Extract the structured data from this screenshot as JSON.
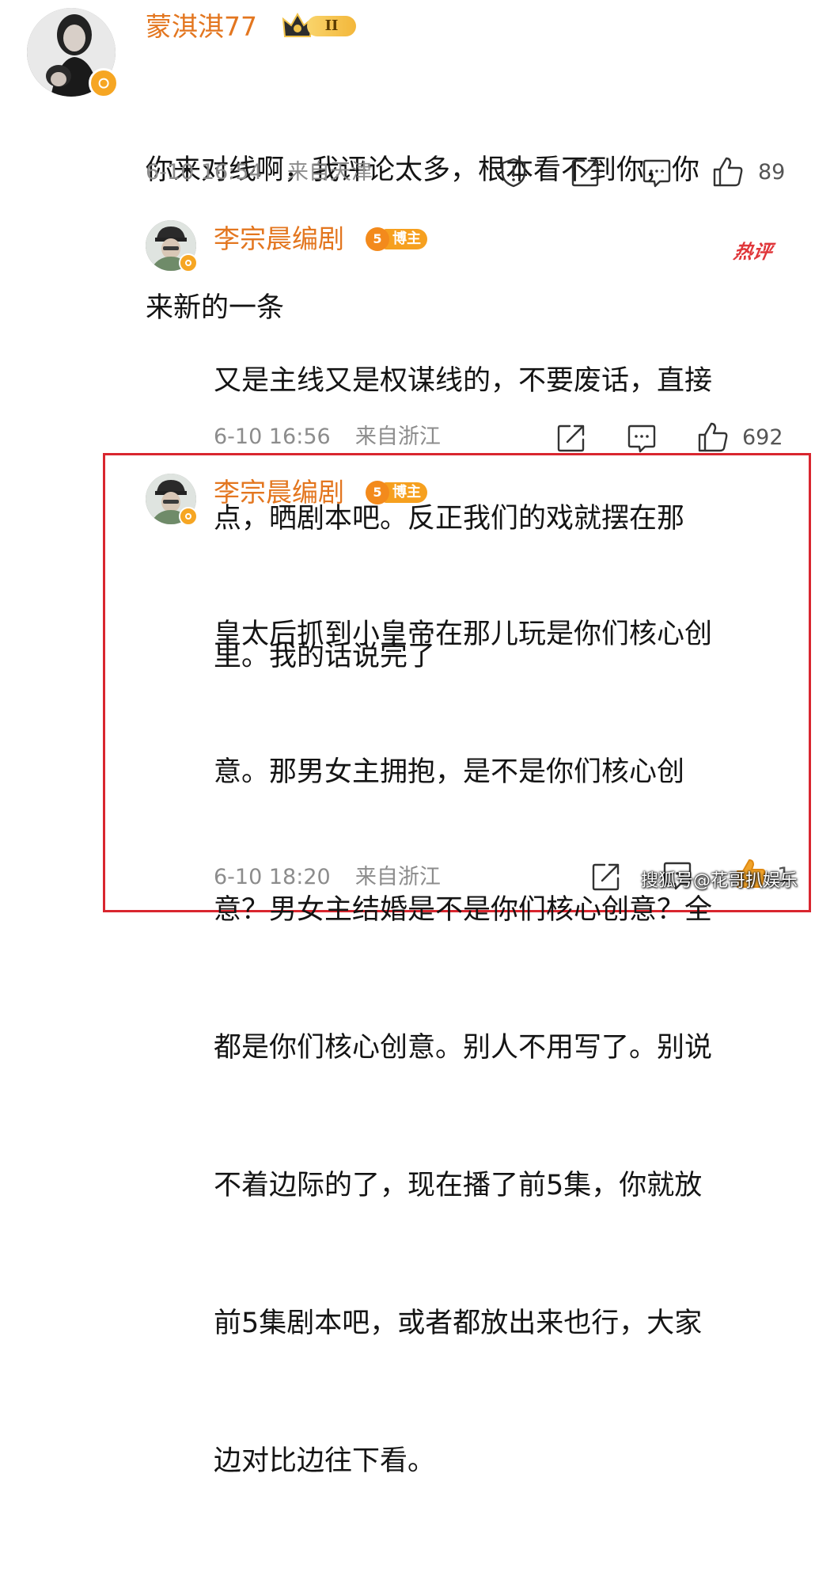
{
  "comments": [
    {
      "username": "蒙淇淇77",
      "vip_level": "II",
      "text_lines": [
        "你来对线啊，我评论太多，根本看不到你，你",
        "来新的一条"
      ],
      "date": "6-10 16:54",
      "location": "来自天津",
      "likes": "89",
      "icons": [
        "report-icon",
        "share-icon",
        "comment-icon",
        "like-icon"
      ]
    },
    {
      "username": "李宗晨编剧",
      "badge": "博主",
      "badge_level": "5",
      "hot_label": "热评",
      "text_lines": [
        "又是主线又是权谋线的，不要废话，直接",
        "点，晒剧本吧。反正我们的戏就摆在那",
        "里。我的话说完了"
      ],
      "date": "6-10 16:56",
      "location": "来自浙江",
      "likes": "692",
      "icons": [
        "share-icon",
        "comment-icon",
        "like-icon"
      ]
    },
    {
      "username": "李宗晨编剧",
      "badge": "博主",
      "badge_level": "5",
      "text_lines": [
        "皇太后抓到小皇帝在那儿玩是你们核心创",
        "意。那男女主拥抱，是不是你们核心创",
        "意？男女主结婚是不是你们核心创意？全",
        "都是你们核心创意。别人不用写了。别说",
        "不着边际的了，现在播了前5集，你就放",
        "前5集剧本吧，或者都放出来也行，大家",
        "边对比边往下看。"
      ],
      "date": "6-10 18:20",
      "location": "来自浙江",
      "likes": "1",
      "icons": [
        "share-icon",
        "comment-icon",
        "like-icon"
      ]
    }
  ],
  "watermark": "搜狐号@花哥扒娱乐",
  "colors": {
    "username": "#e3761f",
    "highlight_border": "#d9262f",
    "hot": "#e0363a",
    "meta": "#8c8c8c"
  }
}
